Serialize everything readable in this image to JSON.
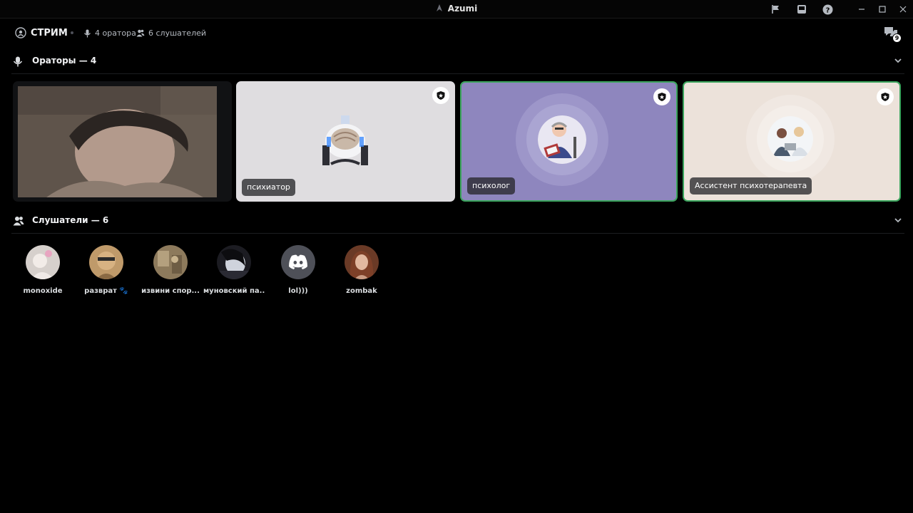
{
  "window": {
    "title": "Azumi"
  },
  "stream": {
    "title": "СТРИМ",
    "speakers_count": "4 оратора",
    "listeners_count": "6 слушателей",
    "threads_badge": "9"
  },
  "speakers_section": {
    "label": "Ораторы — 4"
  },
  "listeners_section": {
    "label": "Слушатели — 6"
  },
  "speakers": [
    {
      "name": "",
      "kind": "video"
    },
    {
      "name": "психиатор",
      "bg": "#dfdde0"
    },
    {
      "name": "психолог",
      "bg": "#8e86be",
      "speaking": true
    },
    {
      "name": "Ассистент психотерапевта",
      "bg": "#ece2da",
      "speaking": true
    }
  ],
  "listeners": [
    {
      "name": "monoxide"
    },
    {
      "name": "разврат 🐾"
    },
    {
      "name": "извини спор..."
    },
    {
      "name": "муновский па..."
    },
    {
      "name": "lol)))"
    },
    {
      "name": "zombak"
    }
  ],
  "colors": {
    "speaking_ring": "#3ba55d",
    "background": "#000000"
  }
}
